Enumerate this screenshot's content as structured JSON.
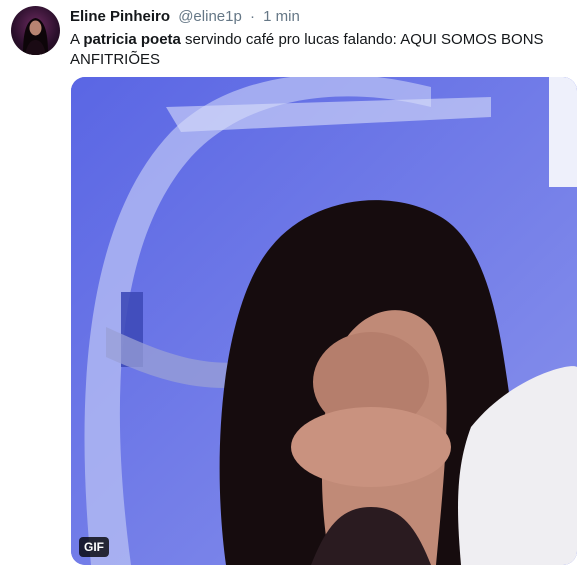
{
  "tweet": {
    "author_name": "Eline Pinheiro",
    "handle": "@eline1p",
    "separator": "·",
    "time": "1 min",
    "text_prefix": "A ",
    "text_bold": "patricia poeta",
    "text_suffix": " servindo café pro lucas falando: AQUI SOMOS BONS ANFITRIÕES",
    "media_badge": "GIF"
  },
  "colors": {
    "name": "#14171a",
    "meta": "#657786",
    "media_background": "#6a78e8"
  }
}
